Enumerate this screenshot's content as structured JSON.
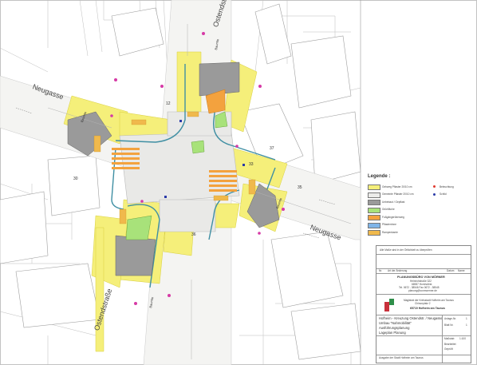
{
  "streets": {
    "neugasse_left": "Neugasse",
    "neugasse_right": "Neugasse",
    "ostendstrasse_top": "Ostendstraße",
    "ostendstrasse_bottom": "Ostendstraße"
  },
  "small_labels": {
    "baumte_top": "Baumte",
    "baumte_bottom": "Baumte",
    "baumte_left": "Baumte",
    "baumte_right": "Baumte"
  },
  "house_numbers": {
    "n12": "12",
    "n30": "30",
    "n33": "33",
    "n35": "35",
    "n36": "36",
    "n37": "37"
  },
  "legend": {
    "title": "Legende :",
    "items": [
      {
        "label": "Gehweg Pflaster 20/10 cm",
        "color": "#f5ef7a"
      },
      {
        "label": "Gemeinte Pflaster 20/10 cm",
        "color": "#ececea"
      },
      {
        "label": "Unbebaut / Gepflast",
        "color": "#9a9a9a"
      },
      {
        "label": "Grünfläche",
        "color": "#a8e27a"
      },
      {
        "label": "Fußgängerüberweg",
        "color": "#f3a23e"
      },
      {
        "label": "Pflasterrinne",
        "color": "#7fb4e8"
      },
      {
        "label": "Rampenkante",
        "color": "#f0b94c"
      }
    ],
    "right_items": [
      {
        "label": "Beleuchtung",
        "color": "#e0392e"
      },
      {
        "label": "Schild",
        "color": "#2a3aa8"
      }
    ]
  },
  "title_block": {
    "note": "Alle Maße sind in der Örtlichkeit zu überprüfen",
    "rev_col1": "Nr.",
    "rev_col2": "Art der Änderung",
    "rev_col3": "Datum",
    "rev_col4": "Name",
    "office_name": "PLANUNGSBÜRO VON MÖRNER",
    "office_line1": "Heinrichstraße 322",
    "office_line2": "66987 Hornhofest",
    "office_line3": "Tel. 0672 - 38546 Fax 0672 - 38545",
    "office_line4": "planung@vonmoerner.de",
    "client_line1": "Magistrat der Kreisstadt Hofheim am Taunus",
    "client_line2": "Chinonplatz 2",
    "client_line3": "65719 Hofheim am Taunus",
    "project_line1": "Hofheim - Kreuzung Ostendstr. / Neugasse",
    "project_line2": "Umbau \"Nahmobilität\"",
    "project_line3": "Ausführungsplanung",
    "project_line4": "Lageplan Planung",
    "plan_no_label": "Anlage-Nr.",
    "plan_no": "1",
    "sheet_label": "Blatt Nr.",
    "sheet": "1",
    "scale_label": "Maßstab",
    "scale": "1:100",
    "drawn_label": "Bearbeitet",
    "checked_label": "Geprüft",
    "footer": "Ausgabe der Stadt Hofheim am Taunus"
  },
  "colors": {
    "sidewalk": "#f5ef7a",
    "road": "#ececea",
    "building": "#9a9a9a",
    "green": "#a8e27a",
    "crossing": "#f3a23e",
    "curb": "#3f8fa3",
    "parcel": "#c9c9c9"
  }
}
